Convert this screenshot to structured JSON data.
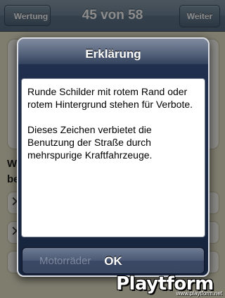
{
  "navbar": {
    "back_label": "Wertung",
    "title": "45 von 58",
    "next_label": "Weiter"
  },
  "question": {
    "text_visible": "W\nbe"
  },
  "answers": [
    {
      "mark": "✕",
      "text": ""
    },
    {
      "mark": "✕",
      "text": ""
    },
    {
      "mark": "",
      "text": ""
    }
  ],
  "alert": {
    "title": "Erklärung",
    "paragraph_1": "Runde Schilder mit rotem Rand oder rotem Hintergrund stehen für Verbote.",
    "paragraph_2": "Dieses Zeichen verbietet die Benutzung der Straße durch mehrspurige Kraftfahrzeuge.",
    "ok_label": "OK",
    "behind_answer_text": "Motorräder"
  },
  "watermark": {
    "logo_text": "Playtform",
    "url": "www.playtform.net"
  }
}
